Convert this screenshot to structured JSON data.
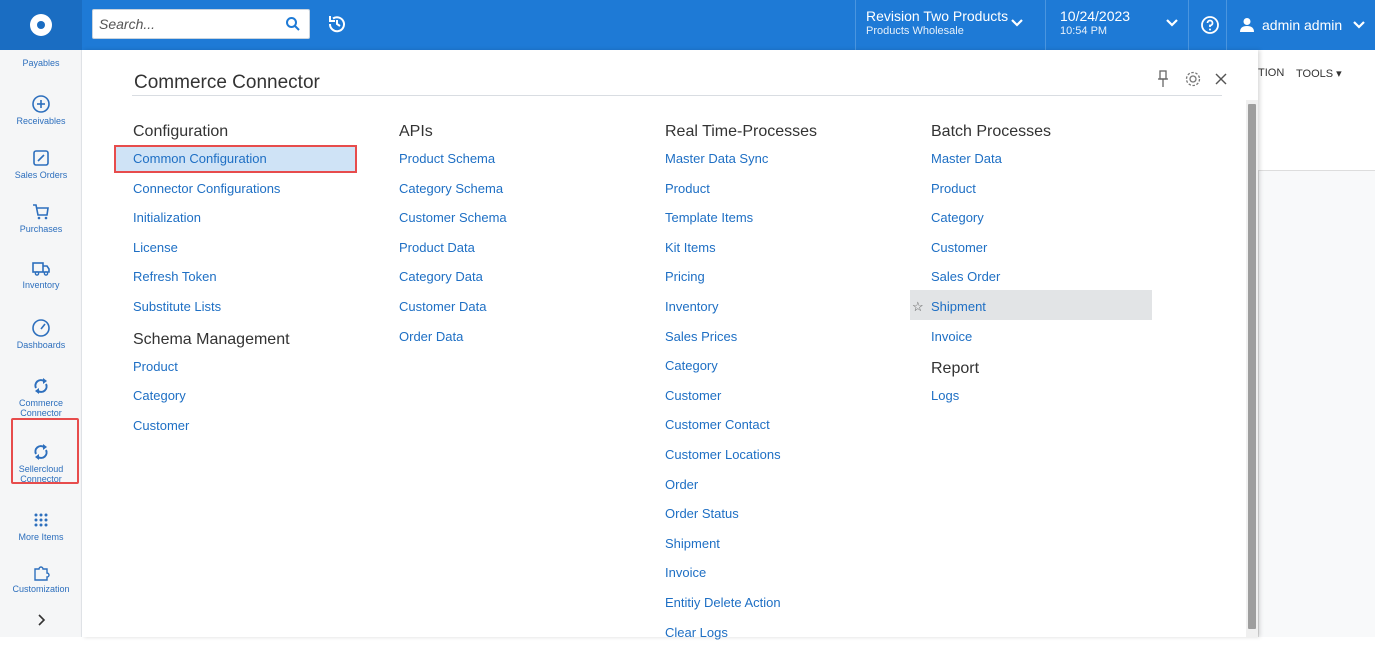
{
  "topbar": {
    "search_placeholder": "Search...",
    "company_line1": "Revision Two Products",
    "company_line2": "Products Wholesale",
    "date_line1": "10/24/2023",
    "date_line2": "10:54 PM",
    "user_name": "admin admin"
  },
  "leftnav": {
    "items": [
      {
        "label": "Payables",
        "icon": "payables-icon"
      },
      {
        "label": "Receivables",
        "icon": "plus-circle-icon"
      },
      {
        "label": "Sales Orders",
        "icon": "edit-icon"
      },
      {
        "label": "Purchases",
        "icon": "cart-icon"
      },
      {
        "label": "Inventory",
        "icon": "truck-icon"
      },
      {
        "label": "Dashboards",
        "icon": "gauge-icon"
      },
      {
        "label": "Commerce Connector",
        "icon": "sync-icon"
      },
      {
        "label": "Sellercloud Connector",
        "icon": "sync-icon"
      },
      {
        "label": "More Items",
        "icon": "grid-icon"
      },
      {
        "label": "Customization",
        "icon": "puzzle-icon"
      }
    ]
  },
  "background": {
    "tab1": "TION",
    "tab2": "TOOLS ▾"
  },
  "panel": {
    "title": "Commerce Connector",
    "columns": [
      {
        "sections": [
          {
            "heading": "Configuration",
            "links": [
              "Common Configuration",
              "Connector Configurations",
              "Initialization",
              "License",
              "Refresh Token",
              "Substitute Lists"
            ]
          },
          {
            "heading": "Schema Management",
            "links": [
              "Product",
              "Category",
              "Customer"
            ]
          }
        ]
      },
      {
        "sections": [
          {
            "heading": "APIs",
            "links": [
              "Product Schema",
              "Category Schema",
              "Customer Schema",
              "Product Data",
              "Category Data",
              "Customer Data",
              "Order Data"
            ]
          }
        ]
      },
      {
        "sections": [
          {
            "heading": "Real Time-Processes",
            "links": [
              "Master Data Sync",
              "Product",
              "Template Items",
              "Kit Items",
              "Pricing",
              "Inventory",
              "Sales Prices",
              "Category",
              "Customer",
              "Customer Contact",
              "Customer Locations",
              "Order",
              "Order Status",
              "Shipment",
              "Invoice",
              "Entitiy Delete Action",
              "Clear Logs"
            ]
          }
        ]
      },
      {
        "sections": [
          {
            "heading": "Batch Processes",
            "links": [
              "Master Data",
              "Product",
              "Category",
              "Customer",
              "Sales Order",
              "Shipment",
              "Invoice"
            ]
          },
          {
            "heading": "Report",
            "links": [
              "Logs"
            ]
          }
        ]
      }
    ],
    "star_glyph": "☆"
  }
}
